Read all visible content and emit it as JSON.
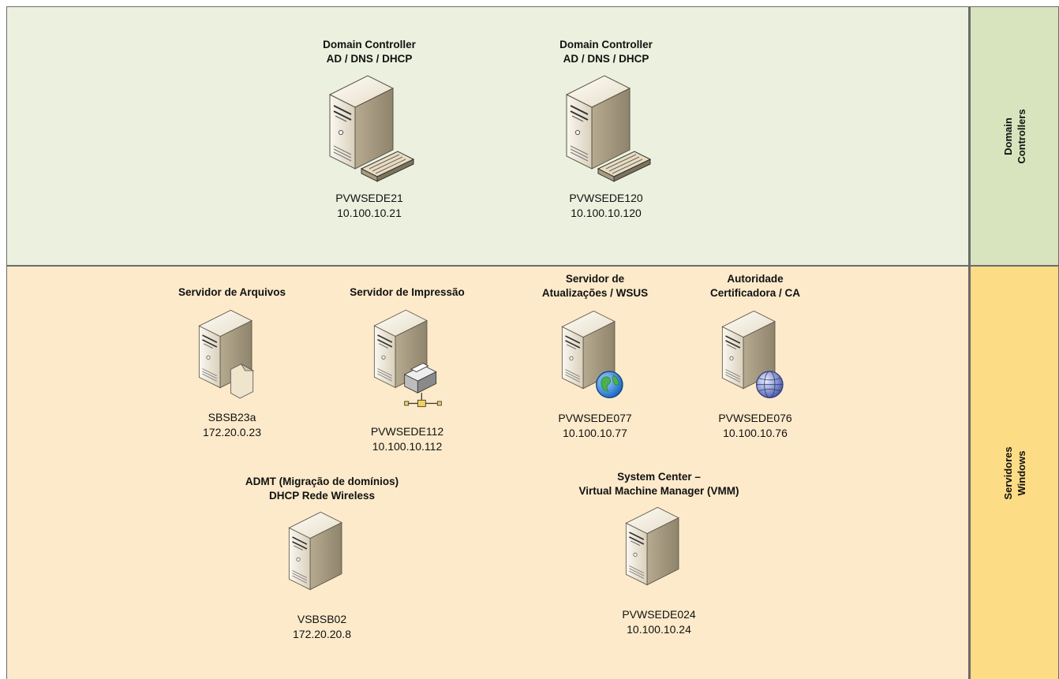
{
  "lanes": {
    "domain_controllers": {
      "line1": "Domain",
      "line2": "Controllers"
    },
    "servidores_windows": {
      "line1": "Servidores",
      "line2": "Windows"
    }
  },
  "colors": {
    "dc_band": "#ebf1de",
    "dc_lane": "#d7e4bd",
    "win_band": "#fdeacb",
    "win_lane": "#fddc86",
    "border": "#6b6b6b"
  },
  "servers": {
    "dc1": {
      "title_line1": "Domain Controller",
      "title_line2": "AD / DNS / DHCP",
      "hostname": "PVWSEDE21",
      "ip": "10.100.10.21",
      "icon": "server-keyboard-icon"
    },
    "dc2": {
      "title_line1": "Domain Controller",
      "title_line2": "AD / DNS / DHCP",
      "hostname": "PVWSEDE120",
      "ip": "10.100.10.120",
      "icon": "server-keyboard-icon"
    },
    "arquivos": {
      "title_line1": "Servidor de Arquivos",
      "title_line2": "",
      "hostname": "SBSB23a",
      "ip": "172.20.0.23",
      "icon": "server-file-icon"
    },
    "impressao": {
      "title_line1": "Servidor de Impressão",
      "title_line2": "",
      "hostname": "PVWSEDE112",
      "ip": "10.100.10.112",
      "icon": "server-printer-icon"
    },
    "wsus": {
      "title_line1": "Servidor de",
      "title_line2": "Atualizações / WSUS",
      "hostname": "PVWSEDE077",
      "ip": "10.100.10.77",
      "icon": "server-globe-icon"
    },
    "ca": {
      "title_line1": "Autoridade",
      "title_line2": "Certificadora / CA",
      "hostname": "PVWSEDE076",
      "ip": "10.100.10.76",
      "icon": "server-web-globe-icon"
    },
    "admt": {
      "title_line1": "ADMT (Migração de domínios)",
      "title_line2": "DHCP Rede Wireless",
      "hostname": "VSBSB02",
      "ip": "172.20.20.8",
      "icon": "server-icon"
    },
    "vmm": {
      "title_line1": "System Center –",
      "title_line2": "Virtual Machine Manager (VMM)",
      "hostname": "PVWSEDE024",
      "ip": "10.100.10.24",
      "icon": "server-icon"
    }
  }
}
